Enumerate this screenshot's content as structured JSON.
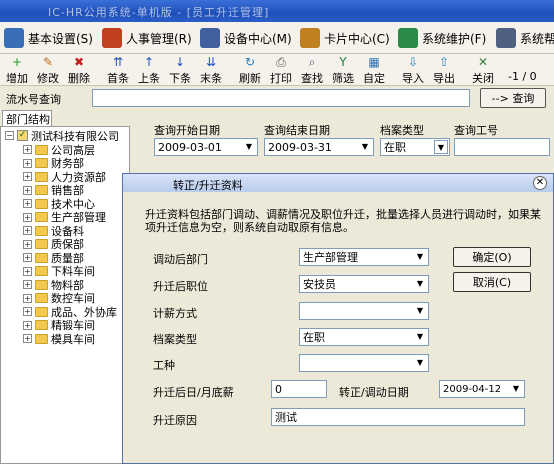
{
  "window": {
    "title": "IC-HR公用系统-单机版 - [员工升迁管理]"
  },
  "menu": [
    {
      "label": "基本设置(S)",
      "color": "#3a6fb8"
    },
    {
      "label": "人事管理(R)",
      "color": "#c04020"
    },
    {
      "label": "设备中心(M)",
      "color": "#4060a0"
    },
    {
      "label": "卡片中心(C)",
      "color": "#c08020"
    },
    {
      "label": "系统维护(F)",
      "color": "#2a8a4a"
    },
    {
      "label": "系统帮",
      "color": "#506080"
    }
  ],
  "toolbar": [
    {
      "label": "增加",
      "icon": "add-icon"
    },
    {
      "label": "修改",
      "icon": "edit-icon"
    },
    {
      "label": "删除",
      "icon": "delete-icon"
    },
    {
      "label": "首条",
      "icon": "first-icon"
    },
    {
      "label": "上条",
      "icon": "prev-icon"
    },
    {
      "label": "下条",
      "icon": "next-icon"
    },
    {
      "label": "末条",
      "icon": "last-icon"
    },
    {
      "label": "刷新",
      "icon": "refresh-icon"
    },
    {
      "label": "打印",
      "icon": "print-icon"
    },
    {
      "label": "查找",
      "icon": "find-icon"
    },
    {
      "label": "筛选",
      "icon": "filter-icon"
    },
    {
      "label": "自定",
      "icon": "custom-icon"
    },
    {
      "label": "导入",
      "icon": "import-icon"
    },
    {
      "label": "导出",
      "icon": "export-icon"
    },
    {
      "label": "关闭",
      "icon": "close-icon"
    }
  ],
  "record_count": "-1 / 0",
  "search": {
    "label": "流水号查询",
    "value": "",
    "button": "--> 查询"
  },
  "tab_label": "部门结构",
  "tree": {
    "root": "测试科技有限公司",
    "items": [
      "公司高层",
      "财务部",
      "人力资源部",
      "销售部",
      "技术中心",
      "生产部管理",
      "设备科",
      "质保部",
      "质量部",
      "下料车间",
      "物料部",
      "数控车间",
      "成品、外协库",
      "精锻车间",
      "模具车间"
    ]
  },
  "filter": {
    "start_label": "查询开始日期",
    "start_value": "2009-03-01",
    "end_label": "查询结束日期",
    "end_value": "2009-03-31",
    "type_label": "档案类型",
    "type_value": "在职",
    "id_label": "查询工号",
    "id_value": ""
  },
  "dialog": {
    "title": "转正/升迁资料",
    "description": "升迁资料包括部门调动、调薪情况及职位升迁，批量选择人员进行调动时，如果某项升迁信息为空，则系统自动取原有信息。",
    "dept_label": "调动后部门",
    "dept_value": "生产部管理",
    "position_label": "升迁后职位",
    "position_value": "安技员",
    "salary_method_label": "计薪方式",
    "salary_method_value": "",
    "archive_label": "档案类型",
    "archive_value": "在职",
    "worktype_label": "工种",
    "worktype_value": "",
    "salary_label": "升迁后日/月底薪",
    "salary_value": "0",
    "date_label": "转正/调动日期",
    "date_value": "2009-04-12",
    "reason_label": "升迁原因",
    "reason_value": "测试",
    "ok_button": "确定(O)",
    "cancel_button": "取消(C)"
  }
}
